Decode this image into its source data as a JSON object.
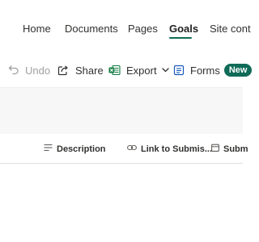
{
  "nav": {
    "items": [
      {
        "label": "Home",
        "active": false
      },
      {
        "label": "Documents",
        "active": false
      },
      {
        "label": "Pages",
        "active": false
      },
      {
        "label": "Goals",
        "active": true
      },
      {
        "label": "Site cont",
        "active": false
      }
    ]
  },
  "toolbar": {
    "undo_label": "Undo",
    "share_label": "Share",
    "export_label": "Export",
    "forms_label": "Forms",
    "new_badge": "New"
  },
  "columns": {
    "description": "Description",
    "link": "Link to Submis...",
    "submit": "Subm"
  },
  "colors": {
    "accent": "#0f6b57",
    "export_icon": "#107c41",
    "forms_icon": "#185abd"
  },
  "icons": {
    "undo": "undo-icon",
    "share": "share-icon",
    "export": "excel-icon",
    "forms": "forms-icon",
    "description": "multiline-text-icon",
    "link": "link-icon",
    "submit": "calendar-icon"
  }
}
